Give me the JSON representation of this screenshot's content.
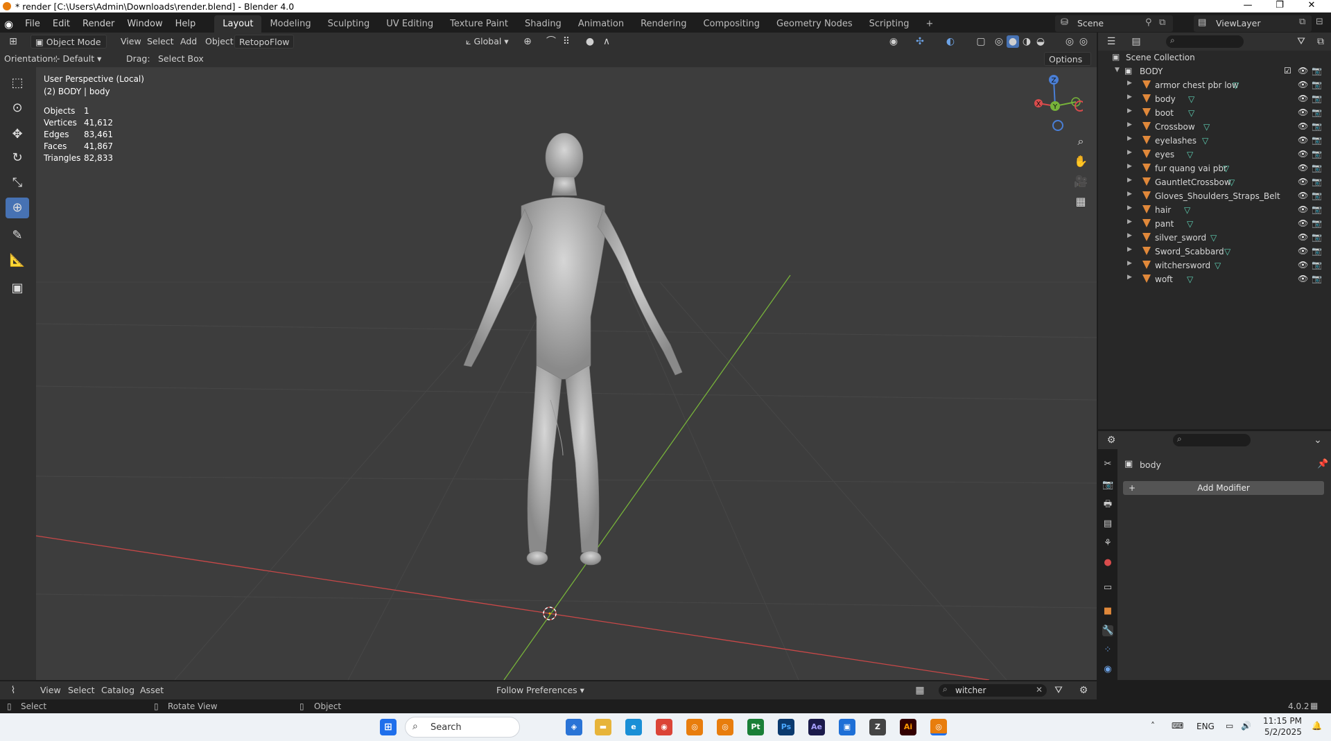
{
  "window": {
    "title": "* render [C:\\Users\\Admin\\Downloads\\render.blend] - Blender 4.0",
    "minimize": "—",
    "maximize": "❐",
    "close": "✕"
  },
  "menu": {
    "items": [
      "File",
      "Edit",
      "Render",
      "Window",
      "Help"
    ],
    "workspaces": [
      "Layout",
      "Modeling",
      "Sculpting",
      "UV Editing",
      "Texture Paint",
      "Shading",
      "Animation",
      "Rendering",
      "Compositing",
      "Geometry Nodes",
      "Scripting"
    ],
    "add_workspace": "+",
    "scene_label": "Scene",
    "viewlayer_label": "ViewLayer"
  },
  "viewport_header": {
    "mode": "Object Mode",
    "menus": [
      "View",
      "Select",
      "Add",
      "Object"
    ],
    "addon": "RetopoFlow",
    "transform_orientation": "Global",
    "orientation_label": "Orientation:",
    "orientation_value": "Default",
    "drag_label": "Drag:",
    "drag_value": "Select Box",
    "options_label": "Options"
  },
  "viewport": {
    "perspective": "User Perspective (Local)",
    "object_info": "(2) BODY | body",
    "stats": [
      {
        "label": "Objects",
        "value": "1"
      },
      {
        "label": "Vertices",
        "value": "41,612"
      },
      {
        "label": "Edges",
        "value": "83,461"
      },
      {
        "label": "Faces",
        "value": "41,867"
      },
      {
        "label": "Triangles",
        "value": "82,833"
      }
    ],
    "gizmo": {
      "z": "Z",
      "y": "Y",
      "x": "X"
    }
  },
  "outliner": {
    "root": "Scene Collection",
    "collection": "BODY",
    "objects": [
      "armor chest pbr low",
      "body",
      "boot",
      "Crossbow",
      "eyelashes",
      "eyes",
      "fur quang vai pbr",
      "GauntletCrossbow",
      "Gloves_Shoulders_Straps_Belt",
      "hair",
      "pant",
      "silver_sword",
      "Sword_Scabbard",
      "witchersword",
      "woft"
    ]
  },
  "properties": {
    "object_name": "body",
    "add_modifier": "Add Modifier"
  },
  "asset_bar": {
    "menus": [
      "View",
      "Select",
      "Catalog",
      "Asset"
    ],
    "follow": "Follow Preferences",
    "search_value": "witcher"
  },
  "statusbar": {
    "select": "Select",
    "rotate": "Rotate View",
    "object": "Object",
    "version": "4.0.2"
  },
  "taskbar": {
    "search": "Search",
    "lang": "ENG",
    "time": "11:15 PM",
    "date": "5/2/2025"
  },
  "colors": {
    "accent": "#4772b3",
    "x_axis": "#d94c4c",
    "y_axis": "#7ec63a",
    "object_orange": "#e0883a",
    "mesh_green": "#5fd1b5"
  }
}
